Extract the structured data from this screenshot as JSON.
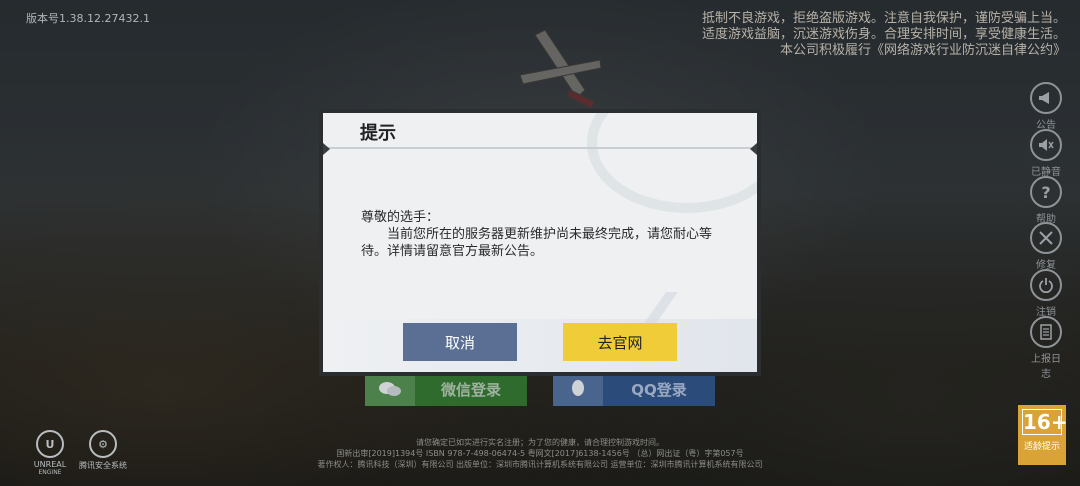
{
  "version_label": "版本号1.38.12.27432.1",
  "health_notice": [
    "抵制不良游戏，拒绝盗版游戏。注意自我保护，谨防受骗上当。",
    "适度游戏益脑，沉迷游戏伤身。合理安排时间，享受健康生活。",
    "本公司积极履行《网络游戏行业防沉迷自律公约》"
  ],
  "side_menu": [
    {
      "label": "公告",
      "icon": "megaphone-icon"
    },
    {
      "label": "已静音",
      "icon": "mute-icon"
    },
    {
      "label": "帮助",
      "icon": "help-icon"
    },
    {
      "label": "修复",
      "icon": "repair-icon"
    },
    {
      "label": "注销",
      "icon": "power-icon"
    },
    {
      "label": "上报日志",
      "icon": "log-icon"
    }
  ],
  "login": {
    "wechat_label": "微信登录",
    "qq_label": "QQ登录"
  },
  "dialog": {
    "title": "提示",
    "greeting": "尊敬的选手：",
    "message": "当前您所在的服务器更新维护尚未最终完成，请您耐心等待。详情请留意官方最新公告。",
    "cancel_label": "取消",
    "website_label": "去官网"
  },
  "footer": {
    "line1": "请您确定已如实进行实名注册；为了您的健康，请合理控制游戏时间。",
    "line2": "国新出审[2019]1394号   ISBN 978-7-498-06474-5   粤网文[2017]6138-1456号 （总）网出证（粤）字第057号",
    "line3": "著作权人：腾讯科技（深圳）有限公司    出版单位：深圳市腾讯计算机系统有限公司    运营单位：深圳市腾讯计算机系统有限公司"
  },
  "logos": {
    "unreal": "UNREAL",
    "unreal_sub": "ENGINE",
    "security": "腾讯安全系统"
  },
  "age_rating": {
    "value": "16+",
    "label": "适龄提示"
  }
}
